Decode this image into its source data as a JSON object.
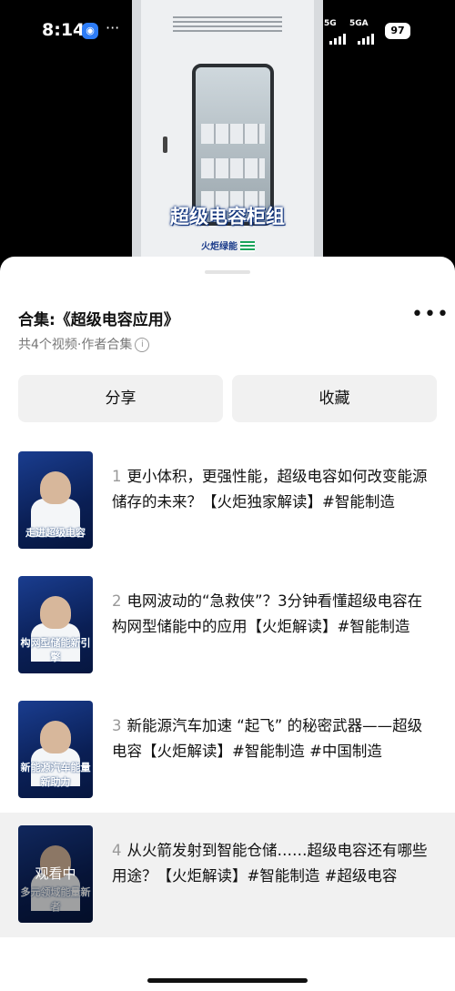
{
  "status_bar": {
    "time": "8:14",
    "more": "···",
    "signal1": "5G",
    "signal2": "5GA",
    "battery": "97"
  },
  "video_preview": {
    "title": "超级电容柜组",
    "logo_text": "火炬绿能"
  },
  "collection": {
    "title": "合集:《超级电容应用》",
    "subtitle": "共4个视频·作者合集",
    "share_label": "分享",
    "favorite_label": "收藏",
    "items": [
      {
        "num": "1",
        "text": "更小体积，更强性能，超级电容如何改变能源储存的未来？【火炬独家解读】#智能制造",
        "thumb_caption": "走进超级电容",
        "overlay": ""
      },
      {
        "num": "2",
        "text": "电网波动的“急救侠”？3分钟看懂超级电容在构网型储能中的应用【火炬解读】#智能制造",
        "thumb_caption": "构网型储能新引擎",
        "overlay": ""
      },
      {
        "num": "3",
        "text": "新能源汽车加速 “起飞” 的秘密武器——超级电容【火炬解读】#智能制造 #中国制造",
        "thumb_caption": "新能源汽车能量新助力",
        "overlay": ""
      },
      {
        "num": "4",
        "text": "从火箭发射到智能仓储……超级电容还有哪些用途？【火炬解读】#智能制造 #超级电容",
        "thumb_caption": "多元领域能量新者",
        "overlay": "观看中"
      }
    ]
  }
}
